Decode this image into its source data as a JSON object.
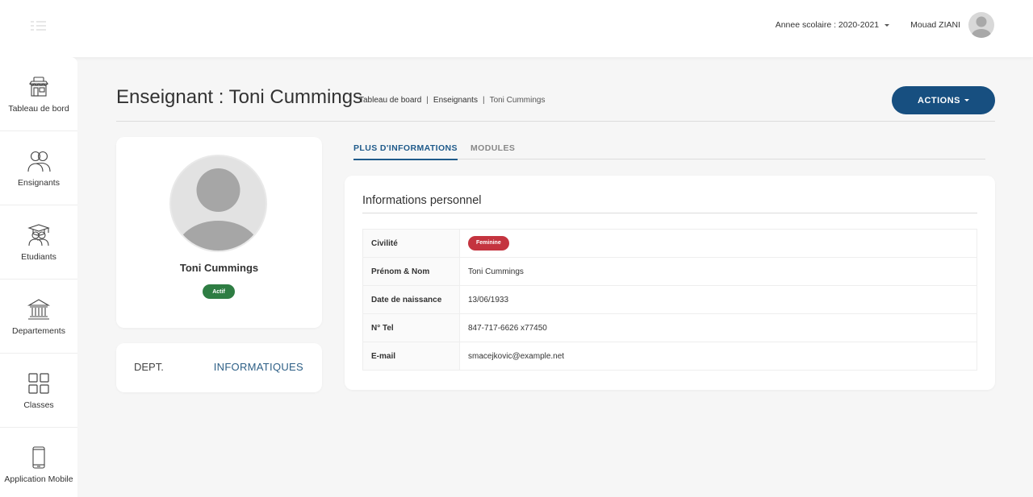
{
  "topbar": {
    "menu_icon": "list-toggle-icon",
    "school_year": "Annee scolaire : 2020-2021",
    "user_name": "Mouad ZIANI"
  },
  "sidebar": {
    "items": [
      {
        "label": "Tableau de bord",
        "icon": "dashboard-shop-icon"
      },
      {
        "label": "Ensignants",
        "icon": "teachers-icon"
      },
      {
        "label": "Etudiants",
        "icon": "students-icon"
      },
      {
        "label": "Departements",
        "icon": "bank-building-icon"
      },
      {
        "label": "Classes",
        "icon": "grid-icon"
      },
      {
        "label": "Application Mobile",
        "icon": "mobile-phone-icon"
      }
    ]
  },
  "header": {
    "title": "Enseignant : Toni Cummings",
    "breadcrumb": [
      "Tableau de board",
      "Enseignants",
      "Toni Cummings"
    ],
    "actions_label": "ACTIONS"
  },
  "profile": {
    "name": "Toni Cummings",
    "status": "Actif",
    "status_color": "#2e7d43"
  },
  "department": {
    "label": "DEPT.",
    "value": "INFORMATIQUES"
  },
  "tabs": [
    "PLUS D'INFORMATIONS",
    "MODULES"
  ],
  "info": {
    "title": "Informations personnel",
    "rows": [
      {
        "label": "Civilité",
        "value": "Feminine"
      },
      {
        "label": "Prénom & Nom",
        "value": "Toni Cummings"
      },
      {
        "label": "Date de naissance",
        "value": "13/06/1933"
      },
      {
        "label": "N° Tel",
        "value": "847-717-6626 x77450"
      },
      {
        "label": "E-mail",
        "value": "smacejkovic@example.net"
      }
    ],
    "gender_badge_color": "#c4343f"
  },
  "colors": {
    "primary": "#174f80",
    "tab_active": "#1f5a8a",
    "background": "#f6f6f6"
  }
}
